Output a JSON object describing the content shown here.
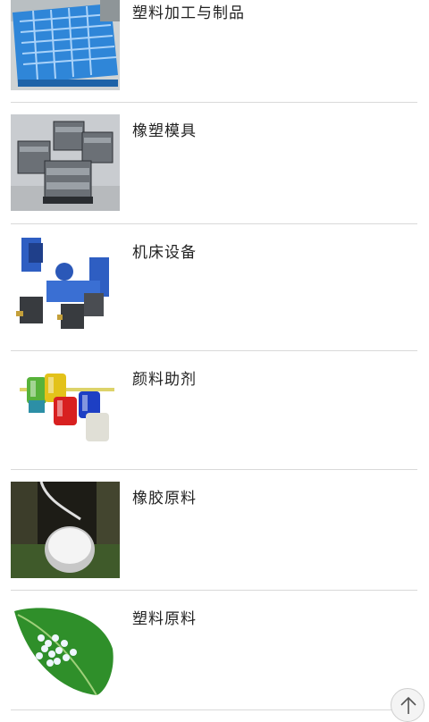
{
  "categories": [
    {
      "label": "塑料加工与制品",
      "image": "blue-plastic-pallet"
    },
    {
      "label": "橡塑模具",
      "image": "steel-mold-sets"
    },
    {
      "label": "机床设备",
      "image": "blue-machine-tool"
    },
    {
      "label": "颜料助剂",
      "image": "colored-pigment-cans"
    },
    {
      "label": "橡胶原料",
      "image": "rubber-latex-tapping"
    },
    {
      "label": "塑料原料",
      "image": "plastic-pellets-on-leaf"
    }
  ],
  "scroll_top": {
    "icon": "arrow-up-icon"
  }
}
